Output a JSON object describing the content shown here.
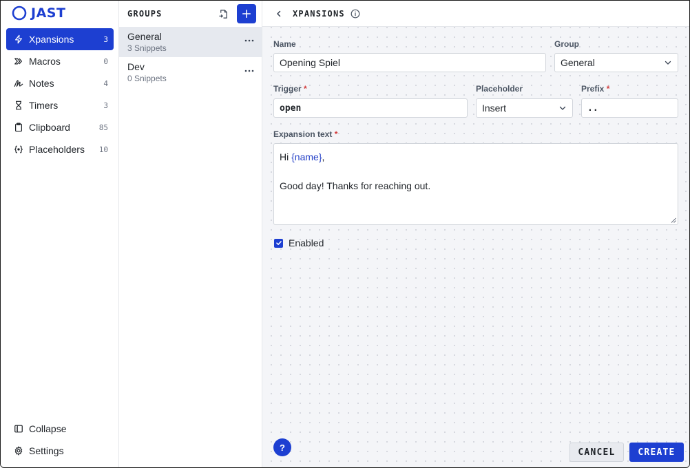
{
  "app": {
    "name": "JAST"
  },
  "sidebar": {
    "items": [
      {
        "label": "Xpansions",
        "count": "3",
        "icon": "bolt-icon",
        "active": true
      },
      {
        "label": "Macros",
        "count": "0",
        "icon": "chevrons-right-icon"
      },
      {
        "label": "Notes",
        "count": "4",
        "icon": "signature-icon"
      },
      {
        "label": "Timers",
        "count": "3",
        "icon": "hourglass-icon"
      },
      {
        "label": "Clipboard",
        "count": "85",
        "icon": "clipboard-icon"
      },
      {
        "label": "Placeholders",
        "count": "10",
        "icon": "braces-icon"
      }
    ],
    "bottom": [
      {
        "label": "Collapse",
        "icon": "sidebar-collapse-icon"
      },
      {
        "label": "Settings",
        "icon": "gear-icon"
      }
    ]
  },
  "groups": {
    "title": "GROUPS",
    "items": [
      {
        "name": "General",
        "sub": "3 Snippets",
        "selected": true
      },
      {
        "name": "Dev",
        "sub": "0 Snippets"
      }
    ]
  },
  "main": {
    "title": "XPANSIONS",
    "form": {
      "name_label": "Name",
      "name_value": "Opening Spiel",
      "group_label": "Group",
      "group_value": "General",
      "trigger_label": "Trigger",
      "trigger_value": "open",
      "placeholder_label": "Placeholder",
      "placeholder_value": "Insert",
      "prefix_label": "Prefix",
      "prefix_value": "..",
      "expansion_label": "Expansion text",
      "expansion_line1_prefix": "Hi ",
      "expansion_line1_token": "{name}",
      "expansion_line1_suffix": ",",
      "expansion_line3": "Good day! Thanks for reaching out.",
      "required_mark": "*",
      "enabled_label": "Enabled",
      "enabled": true
    },
    "help_label": "?",
    "cancel_label": "CANCEL",
    "create_label": "CREATE"
  },
  "colors": {
    "accent": "#1d3fd1",
    "required": "#d23c3c",
    "token": "#2743c8"
  }
}
